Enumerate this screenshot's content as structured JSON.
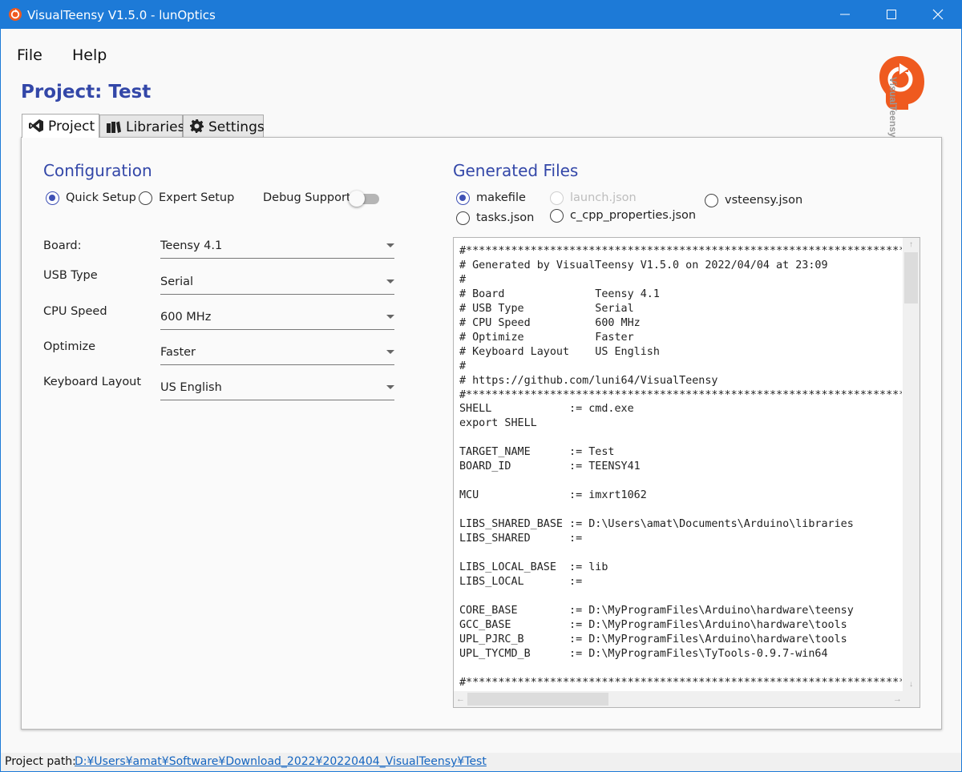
{
  "window": {
    "title": "VisualTeensy V1.5.0 - lunOptics",
    "controls": [
      "minimize-icon",
      "maximize-icon",
      "close-icon"
    ]
  },
  "menu": {
    "file": "File",
    "help": "Help"
  },
  "project_title": "Project: Test",
  "logo_text": "VisualTeensy",
  "tabs": [
    {
      "label": "Project",
      "icon": "visual-studio-icon",
      "active": true
    },
    {
      "label": "Libraries",
      "icon": "books-icon",
      "active": false
    },
    {
      "label": "Settings",
      "icon": "gear-icon",
      "active": false
    }
  ],
  "configuration": {
    "heading": "Configuration",
    "setup_options": [
      {
        "label": "Quick Setup",
        "selected": true
      },
      {
        "label": "Expert Setup",
        "selected": false
      }
    ],
    "debug_label": "Debug Support",
    "debug_enabled": false,
    "fields": [
      {
        "label": "Board:",
        "value": "Teensy 4.1"
      },
      {
        "label": "USB Type",
        "value": "Serial"
      },
      {
        "label": "CPU Speed",
        "value": "600 MHz"
      },
      {
        "label": "Optimize",
        "value": "Faster"
      },
      {
        "label": "Keyboard Layout",
        "value": "US English"
      }
    ]
  },
  "generated_files": {
    "heading": "Generated Files",
    "options": {
      "makefile": {
        "label": "makefile",
        "selected": true,
        "enabled": true
      },
      "launch": {
        "label": "launch.json",
        "selected": false,
        "enabled": false
      },
      "vsteensy": {
        "label": "vsteensy.json",
        "selected": false,
        "enabled": true
      },
      "tasks": {
        "label": "tasks.json",
        "selected": false,
        "enabled": true
      },
      "cpp_props": {
        "label": "c_cpp_properties.json",
        "selected": false,
        "enabled": true
      }
    },
    "code": "#******************************************************************************\n# Generated by VisualTeensy V1.5.0 on 2022/04/04 at 23:09\n#\n# Board              Teensy 4.1\n# USB Type           Serial\n# CPU Speed          600 MHz\n# Optimize           Faster\n# Keyboard Layout    US English\n#\n# https://github.com/luni64/VisualTeensy\n#******************************************************************************\nSHELL            := cmd.exe\nexport SHELL\n\nTARGET_NAME      := Test\nBOARD_ID         := TEENSY41\n\nMCU              := imxrt1062\n\nLIBS_SHARED_BASE := D:\\Users\\amat\\Documents\\Arduino\\libraries\nLIBS_SHARED      :=\n\nLIBS_LOCAL_BASE  := lib\nLIBS_LOCAL       :=\n\nCORE_BASE        := D:\\MyProgramFiles\\Arduino\\hardware\\teensy\nGCC_BASE         := D:\\MyProgramFiles\\Arduino\\hardware\\tools\nUPL_PJRC_B       := D:\\MyProgramFiles\\Arduino\\hardware\\tools\nUPL_TYCMD_B      := D:\\MyProgramFiles\\TyTools-0.9.7-win64\n\n#******************************************************************************"
  },
  "status": {
    "label": "Project path:",
    "path": "D:¥Users¥amat¥Software¥Download_2022¥20220404_VisualTeensy¥Test"
  },
  "colors": {
    "titlebar": "#1d7ad7",
    "accent": "#3347a8",
    "radio": "#3f51b5",
    "logo": "#ef5a1f",
    "link": "#1565c0"
  }
}
